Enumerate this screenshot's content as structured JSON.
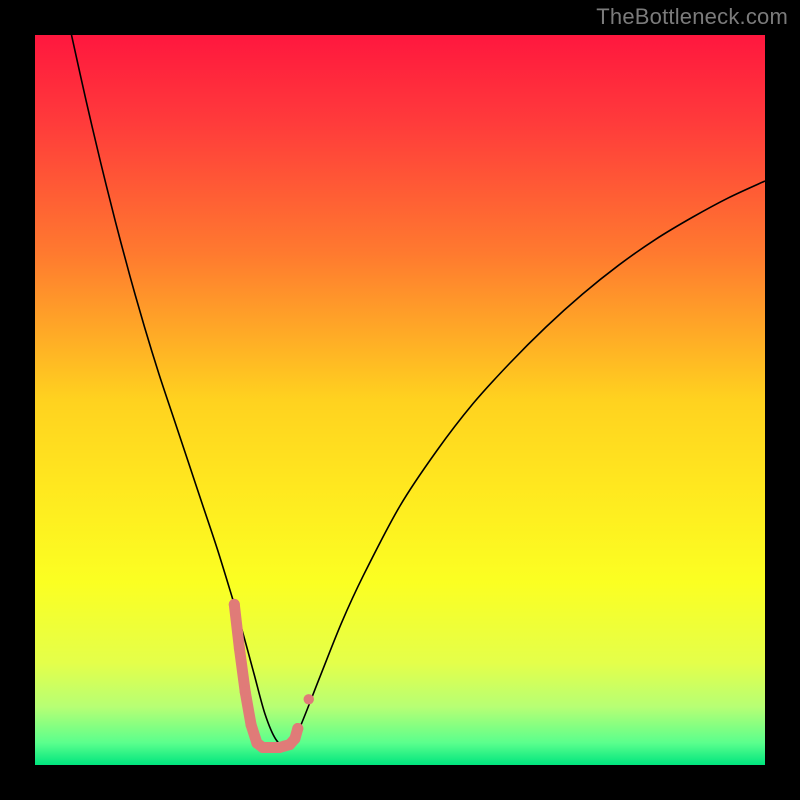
{
  "watermark": "TheBottleneck.com",
  "chart_data": {
    "type": "line",
    "title": "",
    "xlabel": "",
    "ylabel": "",
    "xlim": [
      0,
      100
    ],
    "ylim": [
      0,
      100
    ],
    "background_gradient": {
      "stops": [
        {
          "offset": 0.0,
          "color": "#ff173e"
        },
        {
          "offset": 0.12,
          "color": "#ff3b3b"
        },
        {
          "offset": 0.3,
          "color": "#ff7a2f"
        },
        {
          "offset": 0.5,
          "color": "#ffd21f"
        },
        {
          "offset": 0.62,
          "color": "#ffe81f"
        },
        {
          "offset": 0.75,
          "color": "#fbff22"
        },
        {
          "offset": 0.86,
          "color": "#e4ff4a"
        },
        {
          "offset": 0.92,
          "color": "#b7ff74"
        },
        {
          "offset": 0.97,
          "color": "#5aff8d"
        },
        {
          "offset": 1.0,
          "color": "#00e57e"
        }
      ]
    },
    "series": [
      {
        "name": "bottleneck-curve",
        "type": "curve",
        "color": "#000000",
        "width": 1.6,
        "x": [
          5,
          7,
          9,
          11,
          13,
          15,
          17,
          19,
          21,
          23,
          25,
          27,
          28.5,
          30,
          31.5,
          33,
          34.5,
          36,
          39,
          42,
          45,
          50,
          55,
          60,
          65,
          70,
          75,
          80,
          85,
          90,
          95,
          100
        ],
        "values": [
          100,
          91,
          82.5,
          74.5,
          67,
          60,
          53.5,
          47.5,
          41.5,
          35.5,
          29.5,
          23,
          18,
          12.5,
          7,
          3.5,
          2.5,
          4.5,
          12,
          19.5,
          26,
          35.5,
          43,
          49.5,
          55,
          60,
          64.5,
          68.5,
          72,
          75,
          77.7,
          80
        ]
      },
      {
        "name": "optimal-band",
        "type": "marker-band",
        "color": "#e07b78",
        "stroke_width": 11,
        "dot_radius": 5.5,
        "x": [
          27.3,
          28.0,
          28.8,
          29.6,
          30.4,
          31.2,
          32.0,
          32.8,
          33.5,
          34.2,
          34.9,
          35.6,
          36.0
        ],
        "values": [
          22.0,
          16.0,
          10.0,
          5.5,
          3.0,
          2.4,
          2.4,
          2.4,
          2.4,
          2.6,
          2.8,
          3.6,
          5.0
        ]
      },
      {
        "name": "outlier-dot",
        "type": "dot",
        "color": "#e07b78",
        "radius": 5.2,
        "x": 37.5,
        "value": 9.0
      }
    ]
  }
}
